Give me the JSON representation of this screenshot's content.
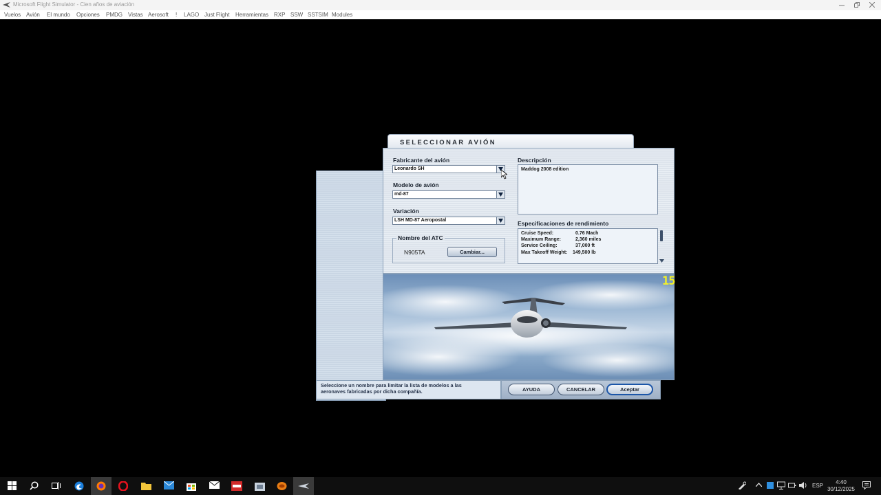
{
  "window": {
    "title": "Microsoft Flight Simulator - Cien años de aviación"
  },
  "menu": [
    "Vuelos",
    "Avión",
    "El mundo",
    "Opciones",
    "PMDG",
    "Vistas",
    "Aerosoft",
    "!",
    "LAGO",
    "Just Flight",
    "Herramientas",
    "RXP",
    "SSW",
    "SSTSIM",
    "Modules"
  ],
  "dialog": {
    "title": "SELECCIONAR AVIÓN",
    "manufacturer": {
      "label": "Fabricante del avión",
      "value": "Leonardo SH"
    },
    "model": {
      "label": "Modelo de avión",
      "value": "md-87"
    },
    "variation": {
      "label": "Variación",
      "value": "LSH MD-87 Aeropostal"
    },
    "atc": {
      "legend": "Nombre del ATC",
      "name": "N905TA",
      "change_button": "Cambiar..."
    },
    "description": {
      "label": "Descripción",
      "text": "Maddog 2008 edition"
    },
    "performance": {
      "label": "Especificaciones de rendimiento",
      "rows": [
        {
          "key": "Cruise Speed:",
          "value": "0.76 Mach"
        },
        {
          "key": "Maximum Range:",
          "value": "2,360 miles"
        },
        {
          "key": "Service Ceiling:",
          "value": "37,000 ft"
        },
        {
          "key": "Max Takeoff Weight:",
          "value": "149,500 lb"
        }
      ]
    },
    "fps_counter": "15",
    "hint": "Seleccione un nombre para limitar la lista de modelos a las aeronaves fabricadas por dicha compañía.",
    "buttons": {
      "help": "AYUDA",
      "cancel": "CANCELAR",
      "accept": "Aceptar"
    }
  },
  "taskbar": {
    "language": "ESP",
    "time": "4:40",
    "date": "30/12/2025",
    "icons": [
      "windows-start-icon",
      "search-icon",
      "task-view-icon",
      "edge-icon",
      "firefox-icon",
      "opera-icon",
      "file-explorer-icon",
      "mail-icon",
      "store-icon",
      "envelope-icon",
      "fsx-launcher-icon",
      "app-icon",
      "firefox-orange-icon",
      "flight-sim-icon"
    ]
  },
  "colors": {
    "dialog_border": "#8aa0b8",
    "accept_border": "#1c56a8",
    "fps": "#f2ef2a"
  }
}
